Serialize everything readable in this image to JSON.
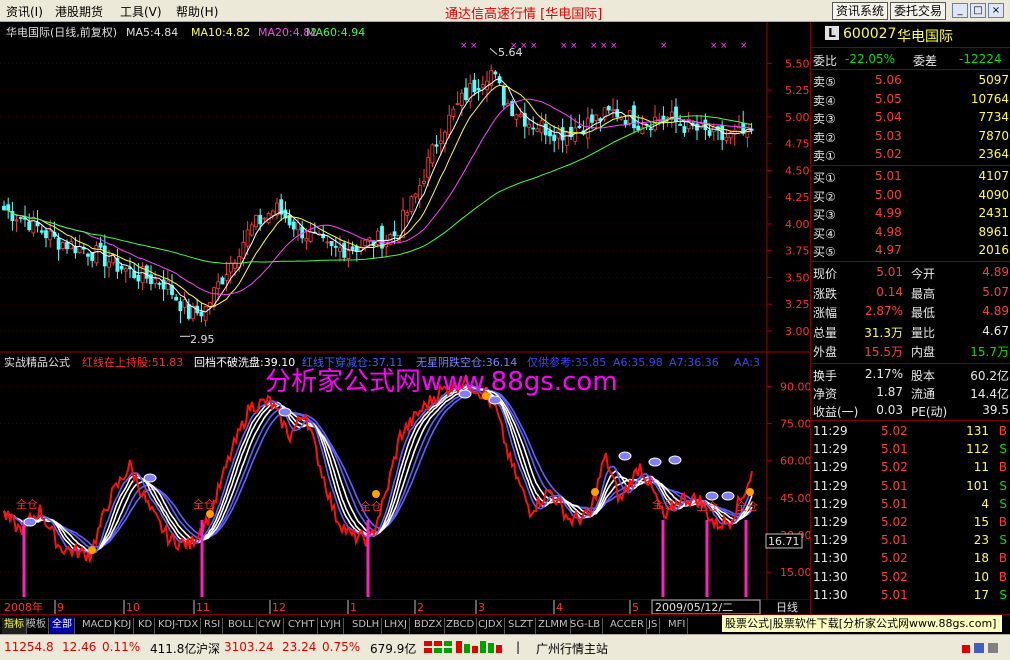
{
  "menu": {
    "items": [
      "资讯(I)",
      "港股期货",
      "工具(V)",
      "帮助(H)"
    ],
    "title": "通达信高速行情 [华电国际]",
    "btn_news": "资讯系统",
    "btn_trade": "委托交易"
  },
  "chart_header": {
    "name": "华电国际(日线,前复权)",
    "ma5": "MA5:4.84",
    "ma10": "MA10:4.82",
    "ma20": "MA20:4.82",
    "ma60": "MA60:4.94"
  },
  "price_axis": [
    "5.50",
    "5.25",
    "5.00",
    "4.75",
    "4.50",
    "4.25",
    "4.00",
    "3.75",
    "3.50",
    "3.25",
    "3.00"
  ],
  "price_marks": {
    "high": "5.64",
    "low": "2.95"
  },
  "indicator_header": {
    "name": "实战精品公式",
    "l1": "红线在上持股:51.83",
    "l2": "回档不破洗盘:39.10",
    "l3": "红线下穿减仓:37.11",
    "l4": "无星阴跌空仓:36.14",
    "l5": "仅供参考:35.85",
    "l6": "A6:35.98",
    "l7": "A7:36.36",
    "l8": "AA:3"
  },
  "watermark": "分析家公式网www.88gs.com",
  "indicator_axis": [
    "90.00",
    "75.00",
    "60.00",
    "45.00",
    "30.00",
    "15.00"
  ],
  "indicator_current": "16.71",
  "full_pos_label": "全仓",
  "date_axis": {
    "year": "2008年",
    "months": [
      "9",
      "10",
      "11",
      "12",
      "1",
      "2",
      "3",
      "4",
      "5"
    ],
    "cursor_date": "2009/05/12/二",
    "period": "日线"
  },
  "quote": {
    "code": "600027",
    "name": "华电国际",
    "weibi_label": "委比",
    "weibi": "-22.05%",
    "weicha_label": "委差",
    "weicha": "-12224",
    "sells": [
      {
        "label": "卖⑤",
        "price": "5.06",
        "vol": "5097"
      },
      {
        "label": "卖④",
        "price": "5.05",
        "vol": "10764"
      },
      {
        "label": "卖③",
        "price": "5.04",
        "vol": "7734"
      },
      {
        "label": "卖②",
        "price": "5.03",
        "vol": "7870"
      },
      {
        "label": "卖①",
        "price": "5.02",
        "vol": "2364"
      }
    ],
    "buys": [
      {
        "label": "买①",
        "price": "5.01",
        "vol": "4107"
      },
      {
        "label": "买②",
        "price": "5.00",
        "vol": "4090"
      },
      {
        "label": "买③",
        "price": "4.99",
        "vol": "2431"
      },
      {
        "label": "买④",
        "price": "4.98",
        "vol": "8961"
      },
      {
        "label": "买⑤",
        "price": "4.97",
        "vol": "2016"
      }
    ],
    "stats": [
      {
        "l1": "现价",
        "v1": "5.01",
        "l2": "今开",
        "v2": "4.89"
      },
      {
        "l1": "涨跌",
        "v1": "0.14",
        "l2": "最高",
        "v2": "5.07"
      },
      {
        "l1": "涨幅",
        "v1": "2.87%",
        "l2": "最低",
        "v2": "4.89"
      },
      {
        "l1": "总量",
        "v1": "31.3万",
        "l2": "量比",
        "v2": "4.67"
      },
      {
        "l1": "外盘",
        "v1": "15.5万",
        "l2": "内盘",
        "v2": "15.7万"
      }
    ],
    "stats2": [
      {
        "l1": "换手",
        "v1": "2.17%",
        "l2": "股本",
        "v2": "60.2亿"
      },
      {
        "l1": "净资",
        "v1": "1.87",
        "l2": "流通",
        "v2": "14.4亿"
      },
      {
        "l1": "收益(一)",
        "v1": "0.03",
        "l2": "PE(动)",
        "v2": "39.5"
      }
    ],
    "ticks": [
      {
        "t": "11:29",
        "p": "5.02",
        "v": "131",
        "s": "B"
      },
      {
        "t": "11:29",
        "p": "5.01",
        "v": "112",
        "s": "S"
      },
      {
        "t": "11:29",
        "p": "5.02",
        "v": "11",
        "s": "B"
      },
      {
        "t": "11:29",
        "p": "5.01",
        "v": "101",
        "s": "S"
      },
      {
        "t": "11:29",
        "p": "5.01",
        "v": "4",
        "s": "S"
      },
      {
        "t": "11:29",
        "p": "5.02",
        "v": "15",
        "s": "B"
      },
      {
        "t": "11:29",
        "p": "5.01",
        "v": "23",
        "s": "S"
      },
      {
        "t": "11:30",
        "p": "5.02",
        "v": "18",
        "s": "B"
      },
      {
        "t": "11:30",
        "p": "5.02",
        "v": "10",
        "s": "B"
      },
      {
        "t": "11:30",
        "p": "5.01",
        "v": "17",
        "s": "S"
      }
    ]
  },
  "tabs": [
    "指标",
    "模板",
    "全部",
    "MACD",
    "KDJ",
    "KD",
    "KDJ-TDX",
    "RSI",
    "BOLL",
    "CYW",
    "CYHT",
    "LYJH",
    "SDLH",
    "LHXJ",
    "BDZX",
    "ZBCD",
    "CJDX",
    "SLZT",
    "ZLMM",
    "SG-LB",
    "ACCER",
    "JS",
    "MFI"
  ],
  "ad_banner": "股票公式|股票软件下载[分析家公式网www.88gs.com]",
  "status": {
    "sh_index": "11254.8",
    "sh_chg": "12.46",
    "sh_pct": "0.11%",
    "sh_amt": "411.8亿",
    "hs_label": "沪深",
    "hs_index": "3103.24",
    "hs_chg": "23.24",
    "hs_pct": "0.75%",
    "hs_amt": "679.9亿",
    "site": "广州行情主站"
  },
  "chart_data": {
    "type": "candlestick",
    "x": [
      "2008-08",
      "2008-09",
      "2008-10",
      "2008-11",
      "2008-12",
      "2009-01",
      "2009-02",
      "2009-03",
      "2009-04",
      "2009-05"
    ],
    "y_close_approx": [
      4.1,
      3.8,
      3.3,
      3.3,
      3.85,
      3.75,
      4.4,
      5.1,
      4.95,
      4.84
    ],
    "ylim": [
      2.85,
      5.7
    ],
    "annotations": [
      {
        "label": "5.64",
        "type": "high"
      },
      {
        "label": "2.95",
        "type": "low"
      }
    ],
    "indicator_ylim": [
      5,
      95
    ]
  }
}
